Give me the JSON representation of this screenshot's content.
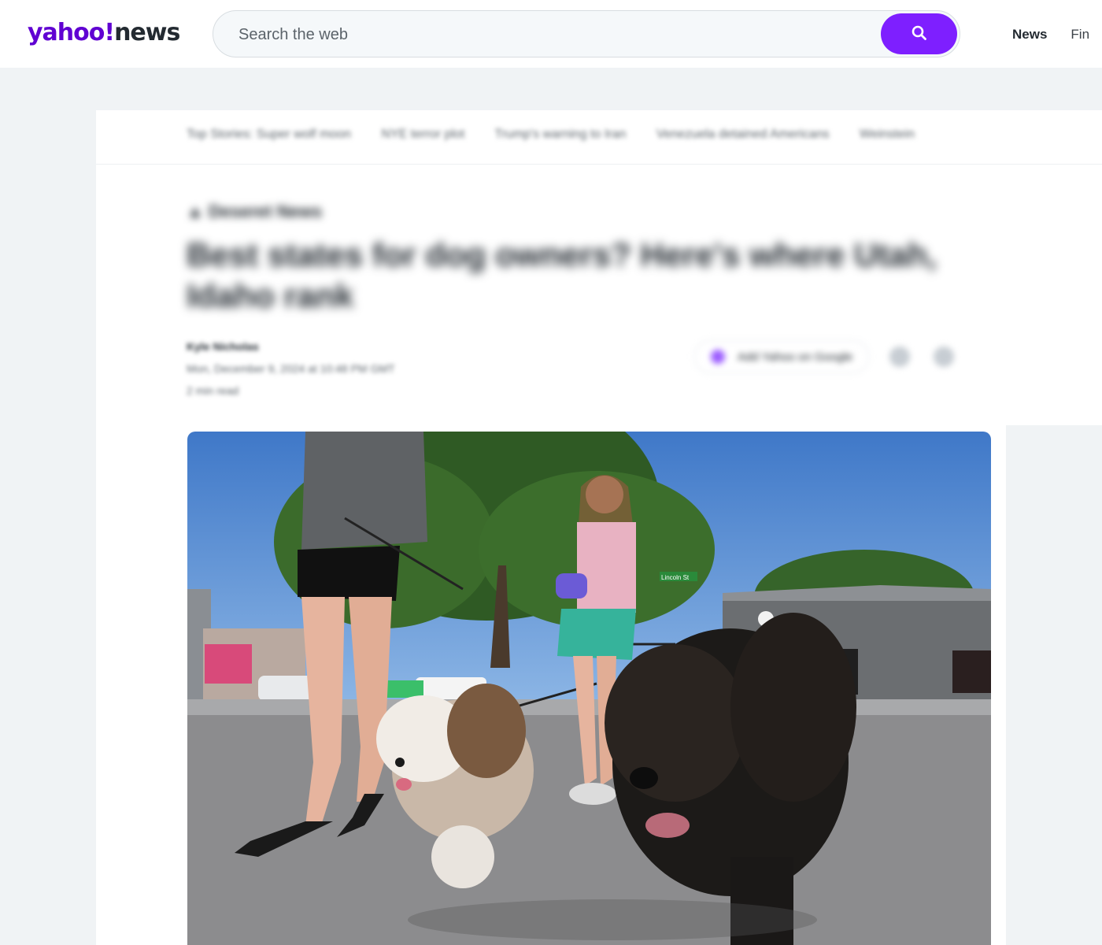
{
  "header": {
    "logo_main": "yahoo!",
    "logo_sub": "news",
    "search_placeholder": "Search the web",
    "nav": [
      "News",
      "Fin"
    ]
  },
  "topics": [
    "Top Stories: Super wolf moon",
    "NYE terror plot",
    "Trump's warning to Iran",
    "Venezuela detained Americans",
    "Weinstein"
  ],
  "article": {
    "provider": "Deseret News",
    "title": "Best states for dog owners? Here's where Utah, Idaho rank",
    "author": "Kyle Nicholas",
    "author_meta": "Mon, December 9, 2024 at 10:48 PM GMT",
    "time": "2 min read",
    "google_btn": "Add Yahoo on Google",
    "image_alt": "Two women walking two dogs on a sunny street",
    "image_sign": "Lincoln St"
  },
  "colors": {
    "brand": "#6001d2",
    "search_button": "#7e1fff"
  }
}
